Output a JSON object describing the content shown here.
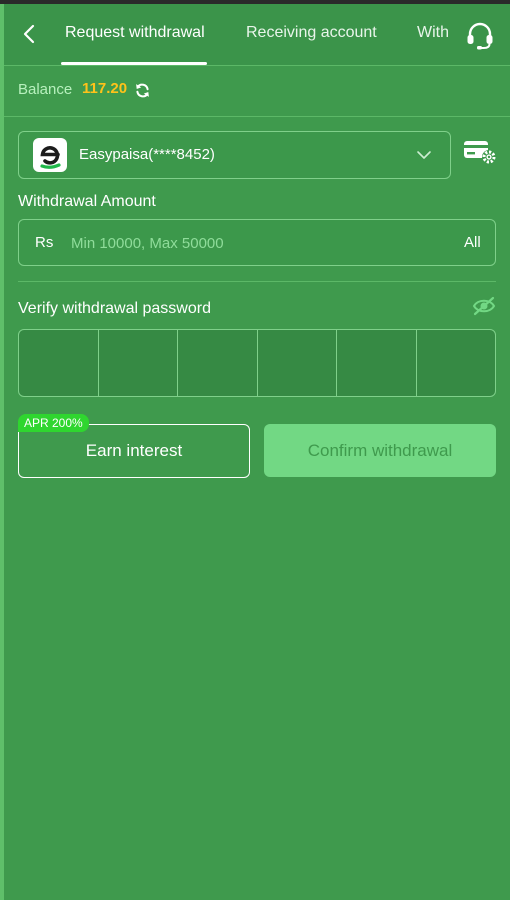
{
  "header": {
    "tabs": [
      {
        "label": "Request withdrawal",
        "active": true
      },
      {
        "label": "Receiving account",
        "active": false
      },
      {
        "label": "With",
        "active": false
      }
    ]
  },
  "balance": {
    "label": "Balance",
    "value": "117.20"
  },
  "account": {
    "selected": "Easypaisa(****8452)"
  },
  "amount": {
    "label": "Withdrawal Amount",
    "currency": "Rs",
    "placeholder": "Min 10000, Max 50000",
    "all_label": "All"
  },
  "password": {
    "label": "Verify withdrawal password",
    "digits": 6
  },
  "actions": {
    "apr_badge": "APR 200%",
    "earn_label": "Earn interest",
    "confirm_label": "Confirm withdrawal"
  },
  "colors": {
    "background": "#3f9a4d",
    "balance_value": "#ffc21a",
    "badge": "#2fd62f",
    "confirm_bg": "#72d884"
  }
}
